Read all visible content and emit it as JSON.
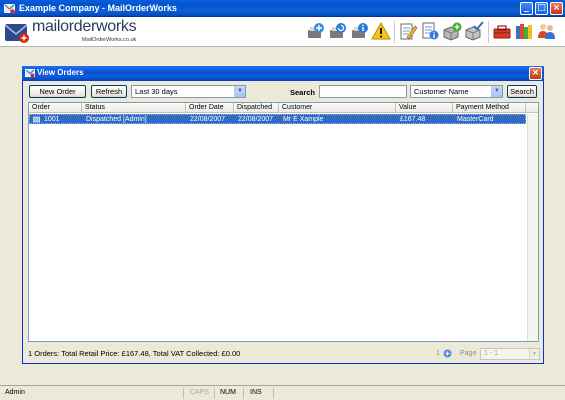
{
  "window": {
    "title": "Example Company - MailOrderWorks",
    "minimize_symbol": "_",
    "maximize_symbol": "□",
    "close_symbol": "×"
  },
  "header": {
    "logo_text": "mailorderworks",
    "logo_subtext": "MailOrderWorks.co.uk",
    "tools": [
      {
        "icon": "globe-add-icon"
      },
      {
        "icon": "globe-refresh-icon"
      },
      {
        "icon": "globe-info-icon"
      },
      {
        "icon": "warning-icon"
      },
      {
        "icon": "notepad-edit-icon"
      },
      {
        "icon": "document-info-icon"
      },
      {
        "icon": "box-add-icon"
      },
      {
        "icon": "box-check-icon"
      },
      {
        "icon": "toolbox-icon"
      },
      {
        "icon": "books-icon"
      },
      {
        "icon": "users-icon"
      }
    ]
  },
  "child_window": {
    "title": "View Orders",
    "close_symbol": "×"
  },
  "controls": {
    "new_order_label": "New Order",
    "refresh_label": "Refresh",
    "period_value": "Last 30 days",
    "search_label": "Search",
    "search_value": "",
    "search_field_value": "Customer Name",
    "search_button_label": "Search"
  },
  "grid": {
    "columns": [
      "Order",
      "Status",
      "Order Date",
      "Dispatched",
      "Customer",
      "Value",
      "Payment Method"
    ],
    "rows": [
      {
        "order": "1001",
        "status": "Dispatched [Admin]",
        "order_date": "22/08/2007",
        "dispatched": "22/08/2007",
        "customer": "Mr E Xample",
        "value": "£167.48",
        "payment_method": "MasterCard"
      }
    ]
  },
  "summary": "1 Orders: Total Retail Price: £167.48, Total VAT Collected: £0.00",
  "pager": {
    "count": "1",
    "page_label": "Page",
    "page_value": "1 - 1"
  },
  "statusbar": {
    "user": "Admin",
    "caps": "CAPS",
    "num": "NUM",
    "ins": "INS"
  },
  "colors": {
    "titlebar": "#0a5ede",
    "selection": "#316ac5",
    "background": "#ece9d8"
  }
}
